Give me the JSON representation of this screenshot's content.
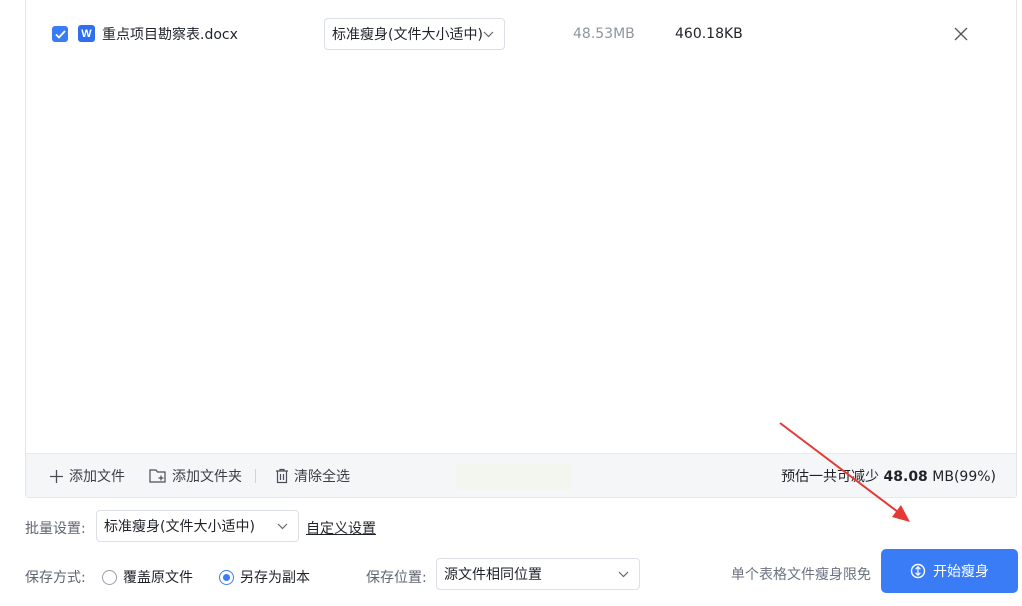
{
  "file_list": {
    "rows": [
      {
        "checked": true,
        "file_type_icon": "W",
        "file_name": "重点项目勘察表.docx",
        "mode": "标准瘦身(文件大小适中)",
        "original_size": "48.53MB",
        "compressed_size": "460.18KB"
      }
    ]
  },
  "toolbar": {
    "add_file": "添加文件",
    "add_folder": "添加文件夹",
    "clear_all": "清除全选",
    "estimate_prefix": "预估一共可减少",
    "estimate_value": "48.08",
    "estimate_suffix": "MB(99%)"
  },
  "batch": {
    "label": "批量设置:",
    "selected": "标准瘦身(文件大小适中)",
    "custom_link": "自定义设置"
  },
  "save": {
    "label": "保存方式:",
    "option_overwrite": "覆盖原文件",
    "option_copy": "另存为副本",
    "selected": "另存为副本",
    "location_label": "保存位置:",
    "location_selected": "源文件相同位置"
  },
  "footer": {
    "free_note": "单个表格文件瘦身限免",
    "start_button": "开始瘦身"
  },
  "colors": {
    "accent": "#3a7cf5",
    "annotation_arrow": "#e53935",
    "word_icon": "#2f6fed"
  }
}
